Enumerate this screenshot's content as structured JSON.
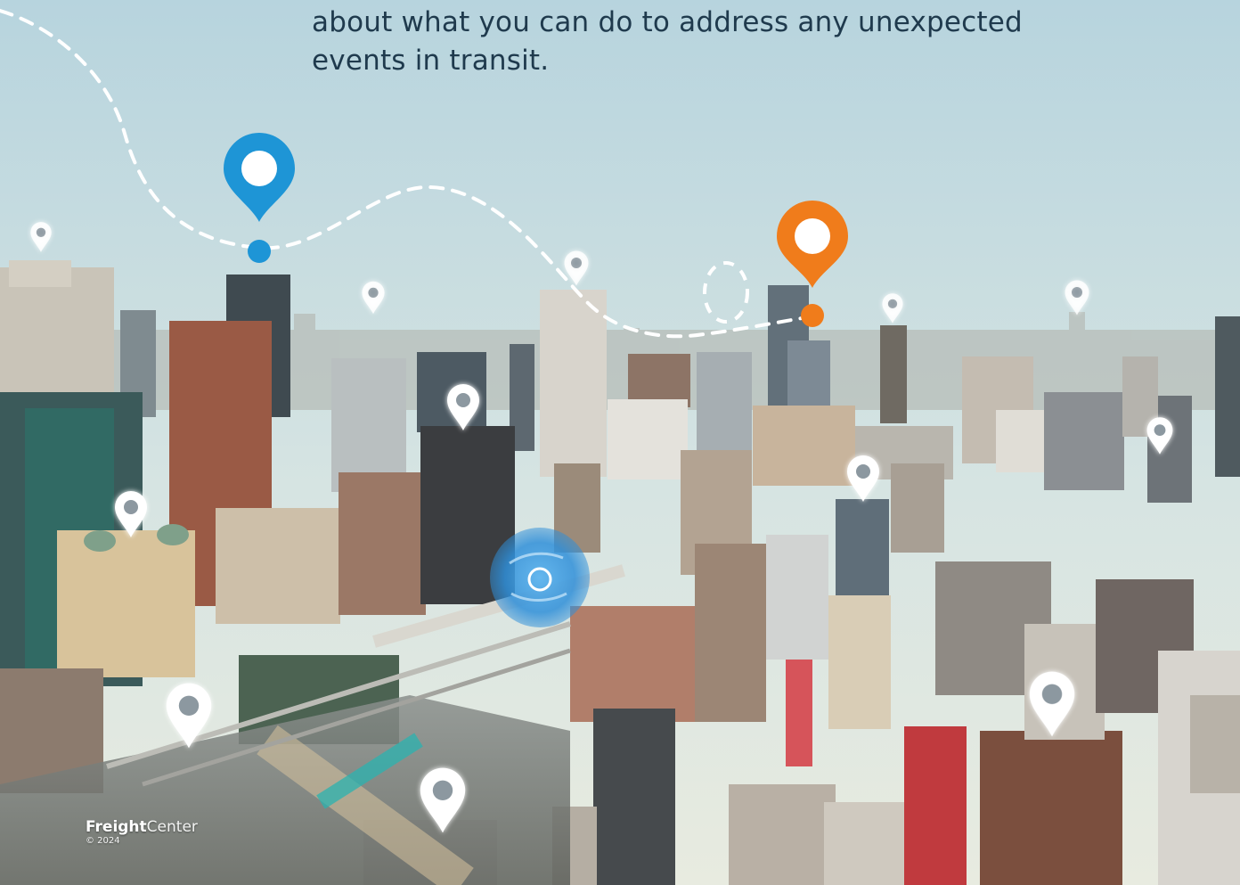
{
  "intro": {
    "line1": "about what you can do to address any unexpected",
    "line2": "events in transit."
  },
  "brand": {
    "name_bold": "Freight",
    "name_regular": "Center",
    "copyright": "© 2024"
  },
  "colors": {
    "sky_top": "#b9d6df",
    "sky_horizon": "#e6ece2",
    "pin_primary": "#1e95d6",
    "pin_accent": "#f07c1b",
    "pin_marker": "#ffffff",
    "route_line": "#ffffff",
    "intro_text": "#1f3a4d"
  },
  "icons": {
    "primary_pin": "map-pin-icon",
    "accent_pin": "map-pin-icon",
    "location_markers": "map-pin-icon",
    "location_hub": "location-target-icon"
  }
}
